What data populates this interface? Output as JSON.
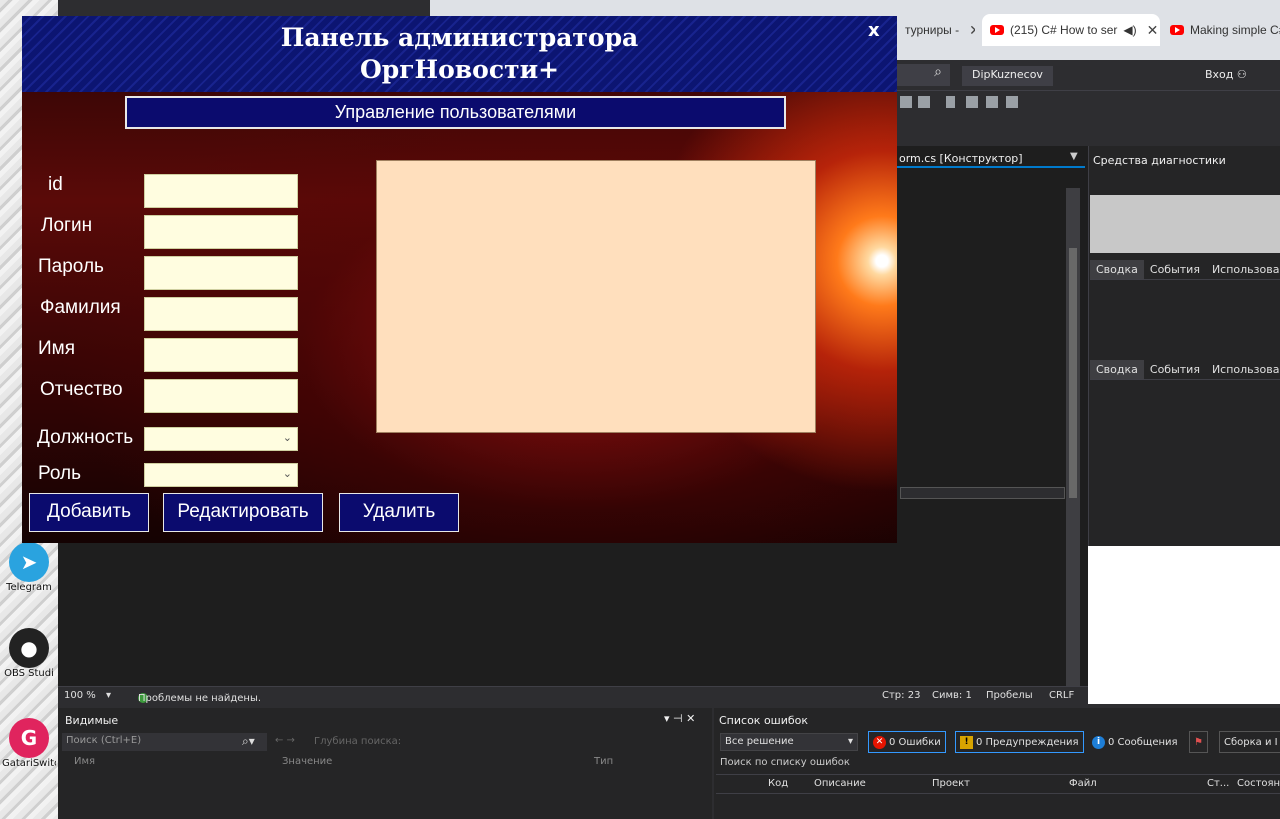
{
  "desktop": {
    "icons": [
      {
        "label": "Telegram",
        "icon": "telegram-icon",
        "color": "#2aa3df"
      },
      {
        "label": "OBS Studi",
        "icon": "obs-icon",
        "color": "#222222"
      },
      {
        "label": "GatariSwitc",
        "icon": "gatari-icon",
        "color": "#e0245e"
      }
    ]
  },
  "browser": {
    "tabs": [
      {
        "label": "турниры -",
        "close": "✕"
      },
      {
        "label": "(215) C# How to ser",
        "close": "✕"
      },
      {
        "label": "Making simple C#",
        "close": ""
      }
    ]
  },
  "vs": {
    "project": "DipKuznecov",
    "login": "Вход",
    "editor_tab": "orm.cs [Конструктор]",
    "diagnostics_title": "Средства диагностики",
    "diag_tabs": [
      "Сводка",
      "События",
      "Использование"
    ],
    "status": {
      "zoom": "100 %",
      "issues": "Проблемы не найдены.",
      "line": "Стр: 23",
      "char": "Симв: 1",
      "spaces": "Пробелы",
      "eol": "CRLF"
    },
    "watch": {
      "title": "Видимые",
      "search_placeholder": "Поиск (Ctrl+E)",
      "depth_label": "Глубина поиска:",
      "columns": [
        "Имя",
        "Значение",
        "Тип"
      ]
    },
    "errors": {
      "title": "Список ошибок",
      "scope": "Все решение",
      "errors_btn": "0 Ошибки",
      "warnings_btn": "0 Предупреждения",
      "messages_btn": "0 Сообщения",
      "build_btn": "Сборка и I",
      "search_placeholder": "Поиск по списку ошибок",
      "columns": [
        "Код",
        "Описание",
        "Проект",
        "Файл",
        "Ст...",
        "Состоян"
      ]
    }
  },
  "admin": {
    "title_line1": "Панель администратора",
    "title_line2": "ОргНовости+",
    "close": "x",
    "section": "Управление пользователями",
    "fields": [
      "id",
      "Логин",
      "Пароль",
      "Фамилия",
      "Имя",
      "Отчество"
    ],
    "selects": [
      "Должность",
      "Роль"
    ],
    "buttons": {
      "add": "Добавить",
      "edit": "Редактировать",
      "delete": "Удалить"
    },
    "colors": {
      "header": "#0c1572",
      "button": "#0b0b6e",
      "input": "#fffde0",
      "grid": "#ffdfbd"
    }
  }
}
